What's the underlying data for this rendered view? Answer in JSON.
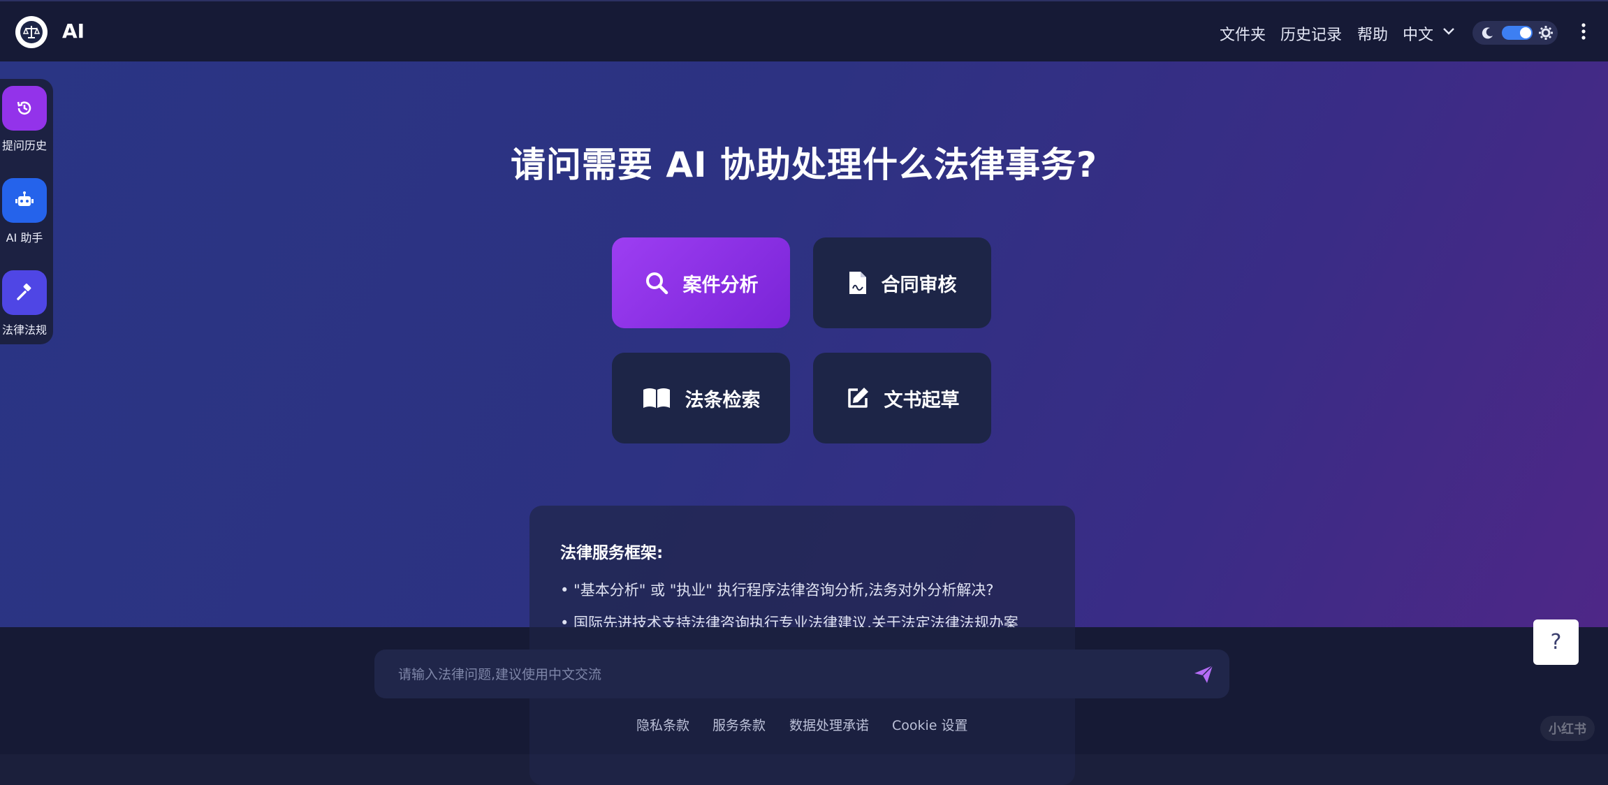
{
  "header": {
    "app_title": "AI",
    "nav": [
      "文件夹",
      "历史记录",
      "帮助"
    ],
    "language": "中文",
    "logo_icon": "scales-of-justice-icon",
    "theme_toggle_on": true
  },
  "sidebar": {
    "items": [
      {
        "label": "提问历史",
        "icon": "history-icon",
        "color": "#9333ea"
      },
      {
        "label": "AI 助手",
        "icon": "robot-icon",
        "color": "#2563eb"
      },
      {
        "label": "法律法规",
        "icon": "gavel-icon",
        "color": "#4f46e5"
      }
    ]
  },
  "main": {
    "headline": "请问需要 AI 协助处理什么法律事务?",
    "actions": [
      {
        "label": "案件分析",
        "icon": "search-icon",
        "active": true
      },
      {
        "label": "合同审核",
        "icon": "contract-file-icon",
        "active": false
      },
      {
        "label": "法条检索",
        "icon": "open-book-icon",
        "active": false
      },
      {
        "label": "文书起草",
        "icon": "edit-icon",
        "active": false
      }
    ],
    "framework": {
      "title": "法律服务框架:",
      "lines": [
        "• \"基本分析\" 或 \"执业\" 执行程序法律咨询分析,法务对外分析解决?",
        "• 国际先进技术支持法律咨询执行专业法律建议,关于法定法律法规办案"
      ]
    }
  },
  "input": {
    "placeholder": "请输入法律问题,建议使用中文交流",
    "value": ""
  },
  "footer": {
    "links": [
      "隐私条款",
      "服务条款",
      "数据处理承诺",
      "Cookie 设置"
    ]
  },
  "help_button": "?",
  "watermark": "小红书",
  "colors": {
    "accent_purple": "#9333ea",
    "toggle_blue": "#3d7ff2",
    "header_bg": "#161a36"
  }
}
